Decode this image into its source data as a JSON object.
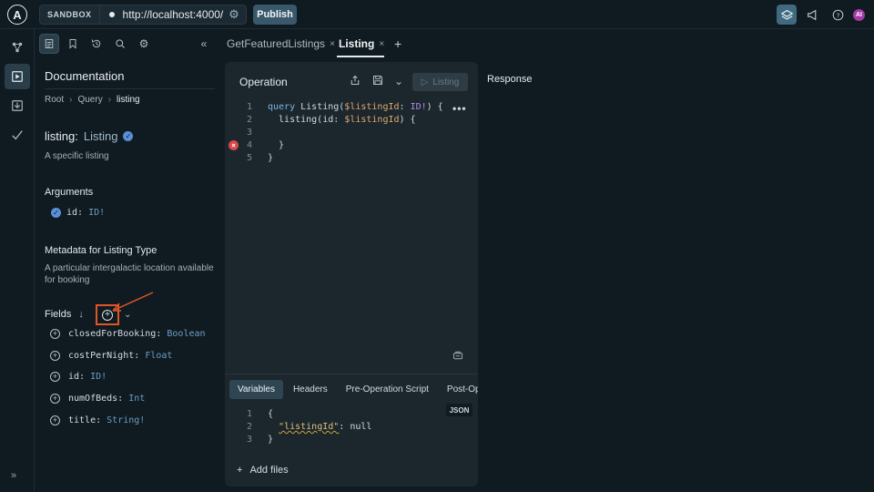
{
  "topbar": {
    "logo_letter": "A",
    "sandbox_label": "SANDBOX",
    "url": "http://localhost:4000/",
    "publish_label": "Publish",
    "avatar_initials": "AI"
  },
  "docs": {
    "title": "Documentation",
    "breadcrumb": [
      "Root",
      "Query",
      "listing"
    ],
    "field_name": "listing:",
    "field_type": "Listing",
    "field_description": "A specific listing",
    "arguments_heading": "Arguments",
    "argument": {
      "name": "id:",
      "type": "ID!"
    },
    "metadata_heading": "Metadata for Listing Type",
    "metadata_description_line1": "A particular intergalactic location available",
    "metadata_description_line2": "for booking",
    "fields_heading": "Fields",
    "fields": [
      {
        "name": "closedForBooking:",
        "type": "Boolean"
      },
      {
        "name": "costPerNight:",
        "type": "Float"
      },
      {
        "name": "id:",
        "type": "ID!"
      },
      {
        "name": "numOfBeds:",
        "type": "Int"
      },
      {
        "name": "title:",
        "type": "String!"
      }
    ]
  },
  "tabs": [
    {
      "label": "GetFeaturedListings",
      "close": "×"
    },
    {
      "label": "Listing",
      "close": "×"
    }
  ],
  "tab_add": "+",
  "operation": {
    "title": "Operation",
    "run_label": "Listing",
    "line_numbers": [
      "1",
      "2",
      "3",
      "4",
      "5"
    ],
    "code": {
      "l1_kw": "query",
      "l1_name": " Listing(",
      "l1_var": "$listingId",
      "l1_colon": ": ",
      "l1_type": "ID!",
      "l1_end": ") {",
      "l2_field": "  listing(id: ",
      "l2_var": "$listingId",
      "l2_end": ") {",
      "l4": "  }",
      "l5": "}"
    }
  },
  "subtabs": [
    "Variables",
    "Headers",
    "Pre-Operation Script",
    "Post-Ope"
  ],
  "json_label": "JSON",
  "variables": {
    "line_numbers": [
      "1",
      "2",
      "3"
    ],
    "l1": "{",
    "l2_key": "\"listingId\"",
    "l2_rest": ": null",
    "l3": "}"
  },
  "add_files_label": "Add files",
  "response_title": "Response",
  "colors": {
    "accent": "#3f6a80",
    "highlight_box": "#e0552a",
    "error": "#d84a4a"
  }
}
